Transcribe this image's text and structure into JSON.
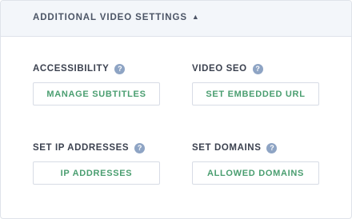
{
  "header": {
    "title": "ADDITIONAL VIDEO SETTINGS",
    "toggle_icon": "caret-up-icon",
    "toggle_glyph": "▲"
  },
  "help_glyph": "?",
  "settings": [
    {
      "label": "ACCESSIBILITY",
      "button": "MANAGE SUBTITLES"
    },
    {
      "label": "VIDEO SEO",
      "button": "SET EMBEDDED URL"
    },
    {
      "label": "SET IP ADDRESSES",
      "button": "IP ADDRESSES"
    },
    {
      "label": "SET DOMAINS",
      "button": "ALLOWED DOMAINS"
    }
  ],
  "colors": {
    "header_bg": "#f3f6fa",
    "border": "#dfe3ea",
    "button_text": "#4a9e70",
    "help_icon_bg": "#8ea4c4"
  }
}
